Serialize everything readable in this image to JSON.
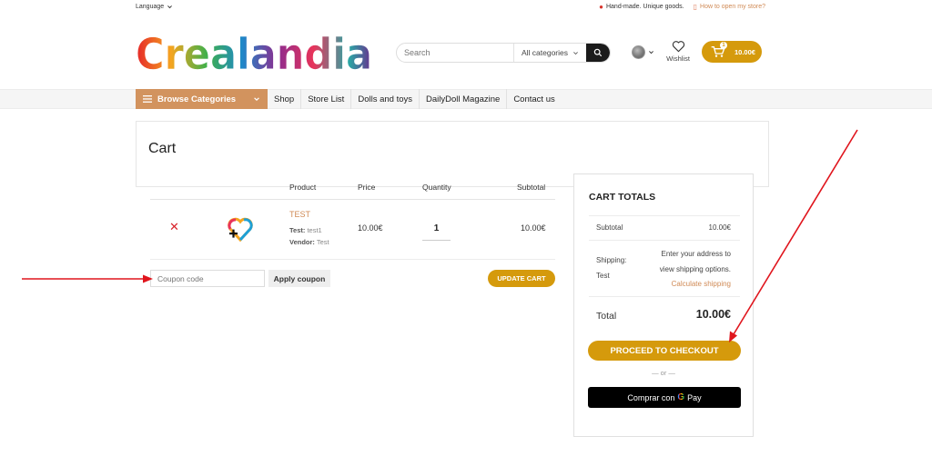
{
  "topbar": {
    "language_label": "Language",
    "tagline": "Hand-made. Unique goods.",
    "store_link": "How to open my store?"
  },
  "header": {
    "logo_text": "Crealandia",
    "search": {
      "placeholder": "Search",
      "category": "All categories"
    },
    "wishlist_label": "Wishlist",
    "cart": {
      "count": "1",
      "amount": "10.00€"
    }
  },
  "nav": {
    "browse_label": "Browse Categories",
    "links": [
      "Shop",
      "Store List",
      "Dolls and toys",
      "DailyDoll Magazine",
      "Contact us"
    ]
  },
  "page": {
    "title": "Cart"
  },
  "cart_table": {
    "headers": {
      "product": "Product",
      "price": "Price",
      "quantity": "Quantity",
      "subtotal": "Subtotal"
    },
    "item": {
      "name": "TEST",
      "meta_test_label": "Test:",
      "meta_test_value": "test1",
      "meta_vendor_label": "Vendor:",
      "meta_vendor_value": "Test",
      "price": "10.00€",
      "quantity": "1",
      "subtotal": "10.00€"
    },
    "coupon_placeholder": "Coupon code",
    "apply_label": "Apply coupon",
    "update_label": "UPDATE CART"
  },
  "totals": {
    "title": "CART TOTALS",
    "subtotal_label": "Subtotal",
    "subtotal_value": "10.00€",
    "shipping_label_1": "Shipping:",
    "shipping_label_2": "Test",
    "shipping_line_1": "Enter your address to",
    "shipping_line_2": "view shipping options.",
    "shipping_calc": "Calculate shipping",
    "total_label": "Total",
    "total_value": "10.00€",
    "checkout_label": "PROCEED TO CHECKOUT",
    "or_label": "— or —",
    "gpay_prefix": "Comprar con",
    "gpay_pay": "Pay"
  },
  "colors": {
    "accent": "#d59a0c",
    "browse": "#d2935e",
    "link": "#d08a55",
    "annotation": "#e0151d"
  }
}
